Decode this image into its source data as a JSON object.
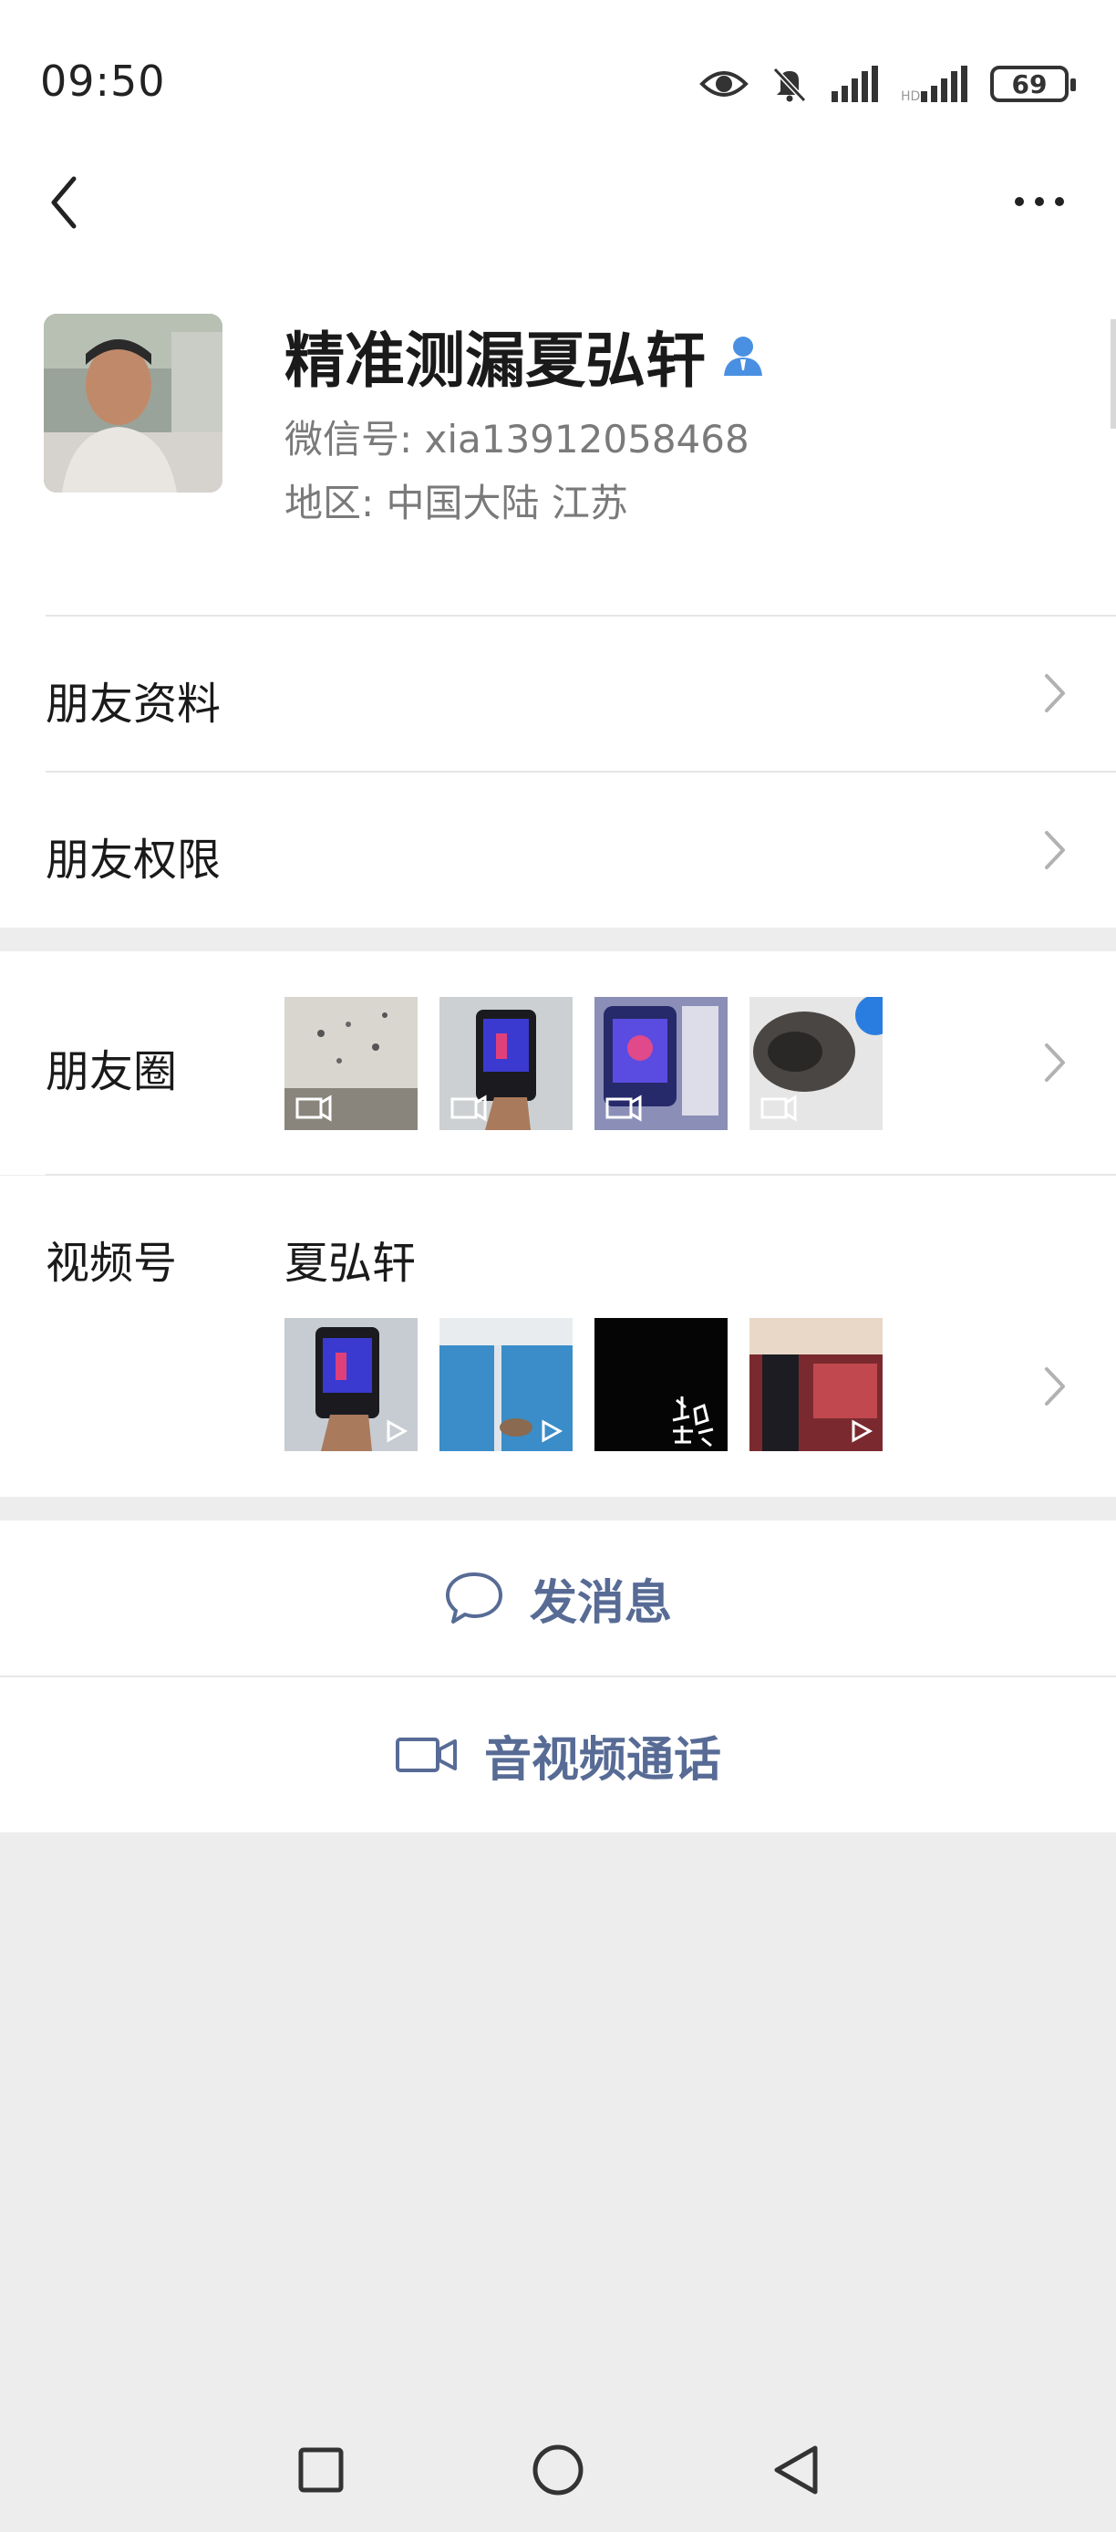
{
  "status_bar": {
    "time": "09:50",
    "battery": "69",
    "icons": [
      "eye-icon",
      "mute-bell-icon",
      "signal-icon",
      "signal-icon-2",
      "battery-icon"
    ]
  },
  "nav": {
    "back_icon": "chevron-left-icon",
    "more_icon": "more-icon"
  },
  "profile": {
    "name": "精准测漏夏弘轩",
    "verified_icon": "person-icon",
    "wechat_id": "微信号:  xia13912058468",
    "region": "地区:  中国大陆  江苏"
  },
  "menu": {
    "friend_info": "朋友资料",
    "friend_permissions": "朋友权限",
    "moments": "朋友圈",
    "channels": "视频号",
    "channels_name": "夏弘轩"
  },
  "actions": {
    "message": "发消息",
    "call": "音视频通话"
  },
  "colors": {
    "link": "#576b95",
    "background": "#ededed",
    "verified": "#4a90e2"
  }
}
